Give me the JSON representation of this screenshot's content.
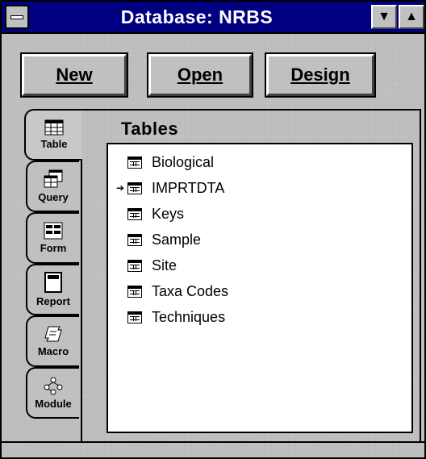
{
  "window": {
    "title": "Database: NRBS",
    "minimize_glyph": "▼",
    "maximize_glyph": "▲"
  },
  "buttons": {
    "new": "New",
    "open": "Open",
    "design": "Design"
  },
  "tabs": [
    {
      "label": "Table",
      "icon": "table-icon"
    },
    {
      "label": "Query",
      "icon": "query-icon"
    },
    {
      "label": "Form",
      "icon": "form-icon"
    },
    {
      "label": "Report",
      "icon": "report-icon"
    },
    {
      "label": "Macro",
      "icon": "macro-icon"
    },
    {
      "label": "Module",
      "icon": "module-icon"
    }
  ],
  "list": {
    "title": "Tables",
    "items": [
      "Biological",
      "IMPRTDTA",
      "Keys",
      "Sample",
      "Site",
      "Taxa Codes",
      "Techniques"
    ],
    "focus_marker": "➔"
  }
}
